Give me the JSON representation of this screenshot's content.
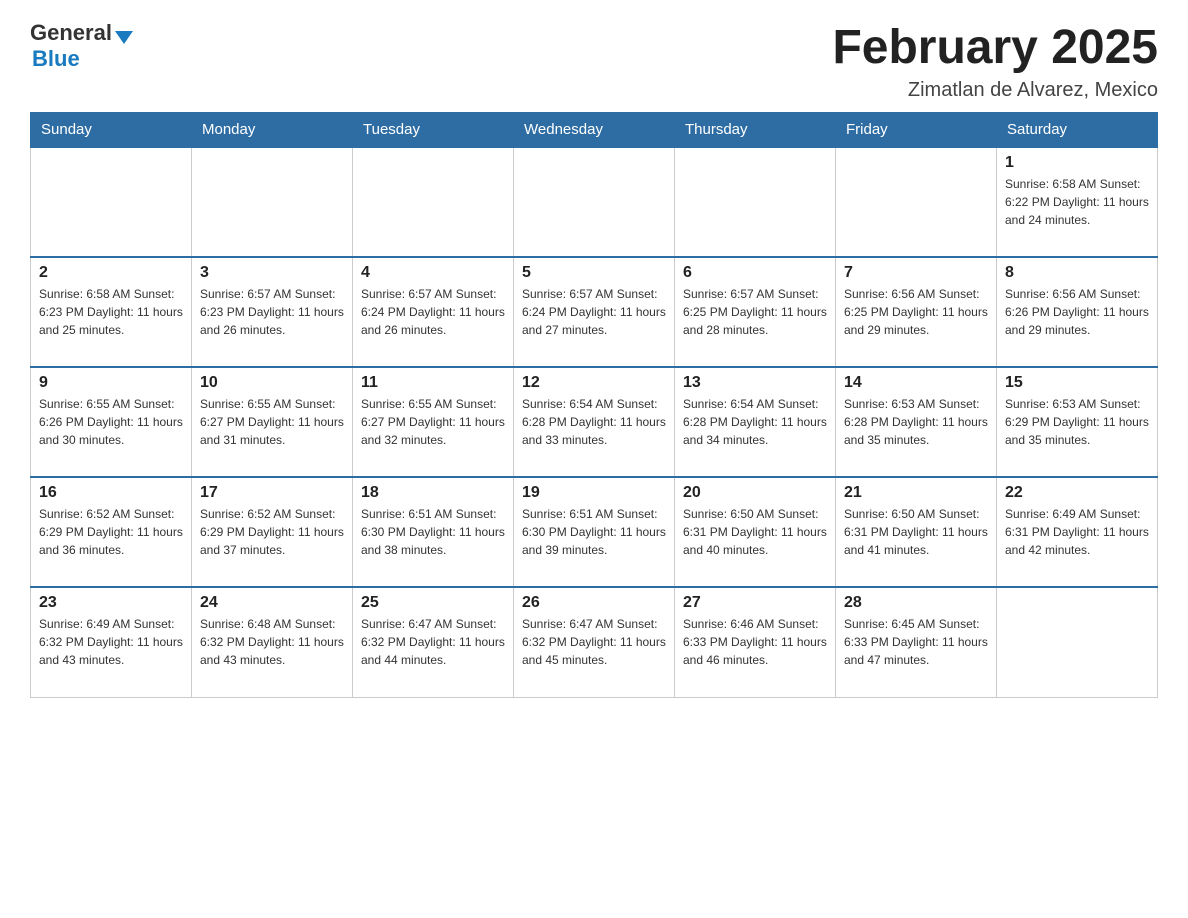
{
  "header": {
    "logo_general": "General",
    "logo_blue": "Blue",
    "title": "February 2025",
    "location": "Zimatlan de Alvarez, Mexico"
  },
  "weekdays": [
    "Sunday",
    "Monday",
    "Tuesday",
    "Wednesday",
    "Thursday",
    "Friday",
    "Saturday"
  ],
  "weeks": [
    [
      {
        "day": "",
        "info": ""
      },
      {
        "day": "",
        "info": ""
      },
      {
        "day": "",
        "info": ""
      },
      {
        "day": "",
        "info": ""
      },
      {
        "day": "",
        "info": ""
      },
      {
        "day": "",
        "info": ""
      },
      {
        "day": "1",
        "info": "Sunrise: 6:58 AM\nSunset: 6:22 PM\nDaylight: 11 hours and 24 minutes."
      }
    ],
    [
      {
        "day": "2",
        "info": "Sunrise: 6:58 AM\nSunset: 6:23 PM\nDaylight: 11 hours and 25 minutes."
      },
      {
        "day": "3",
        "info": "Sunrise: 6:57 AM\nSunset: 6:23 PM\nDaylight: 11 hours and 26 minutes."
      },
      {
        "day": "4",
        "info": "Sunrise: 6:57 AM\nSunset: 6:24 PM\nDaylight: 11 hours and 26 minutes."
      },
      {
        "day": "5",
        "info": "Sunrise: 6:57 AM\nSunset: 6:24 PM\nDaylight: 11 hours and 27 minutes."
      },
      {
        "day": "6",
        "info": "Sunrise: 6:57 AM\nSunset: 6:25 PM\nDaylight: 11 hours and 28 minutes."
      },
      {
        "day": "7",
        "info": "Sunrise: 6:56 AM\nSunset: 6:25 PM\nDaylight: 11 hours and 29 minutes."
      },
      {
        "day": "8",
        "info": "Sunrise: 6:56 AM\nSunset: 6:26 PM\nDaylight: 11 hours and 29 minutes."
      }
    ],
    [
      {
        "day": "9",
        "info": "Sunrise: 6:55 AM\nSunset: 6:26 PM\nDaylight: 11 hours and 30 minutes."
      },
      {
        "day": "10",
        "info": "Sunrise: 6:55 AM\nSunset: 6:27 PM\nDaylight: 11 hours and 31 minutes."
      },
      {
        "day": "11",
        "info": "Sunrise: 6:55 AM\nSunset: 6:27 PM\nDaylight: 11 hours and 32 minutes."
      },
      {
        "day": "12",
        "info": "Sunrise: 6:54 AM\nSunset: 6:28 PM\nDaylight: 11 hours and 33 minutes."
      },
      {
        "day": "13",
        "info": "Sunrise: 6:54 AM\nSunset: 6:28 PM\nDaylight: 11 hours and 34 minutes."
      },
      {
        "day": "14",
        "info": "Sunrise: 6:53 AM\nSunset: 6:28 PM\nDaylight: 11 hours and 35 minutes."
      },
      {
        "day": "15",
        "info": "Sunrise: 6:53 AM\nSunset: 6:29 PM\nDaylight: 11 hours and 35 minutes."
      }
    ],
    [
      {
        "day": "16",
        "info": "Sunrise: 6:52 AM\nSunset: 6:29 PM\nDaylight: 11 hours and 36 minutes."
      },
      {
        "day": "17",
        "info": "Sunrise: 6:52 AM\nSunset: 6:29 PM\nDaylight: 11 hours and 37 minutes."
      },
      {
        "day": "18",
        "info": "Sunrise: 6:51 AM\nSunset: 6:30 PM\nDaylight: 11 hours and 38 minutes."
      },
      {
        "day": "19",
        "info": "Sunrise: 6:51 AM\nSunset: 6:30 PM\nDaylight: 11 hours and 39 minutes."
      },
      {
        "day": "20",
        "info": "Sunrise: 6:50 AM\nSunset: 6:31 PM\nDaylight: 11 hours and 40 minutes."
      },
      {
        "day": "21",
        "info": "Sunrise: 6:50 AM\nSunset: 6:31 PM\nDaylight: 11 hours and 41 minutes."
      },
      {
        "day": "22",
        "info": "Sunrise: 6:49 AM\nSunset: 6:31 PM\nDaylight: 11 hours and 42 minutes."
      }
    ],
    [
      {
        "day": "23",
        "info": "Sunrise: 6:49 AM\nSunset: 6:32 PM\nDaylight: 11 hours and 43 minutes."
      },
      {
        "day": "24",
        "info": "Sunrise: 6:48 AM\nSunset: 6:32 PM\nDaylight: 11 hours and 43 minutes."
      },
      {
        "day": "25",
        "info": "Sunrise: 6:47 AM\nSunset: 6:32 PM\nDaylight: 11 hours and 44 minutes."
      },
      {
        "day": "26",
        "info": "Sunrise: 6:47 AM\nSunset: 6:32 PM\nDaylight: 11 hours and 45 minutes."
      },
      {
        "day": "27",
        "info": "Sunrise: 6:46 AM\nSunset: 6:33 PM\nDaylight: 11 hours and 46 minutes."
      },
      {
        "day": "28",
        "info": "Sunrise: 6:45 AM\nSunset: 6:33 PM\nDaylight: 11 hours and 47 minutes."
      },
      {
        "day": "",
        "info": ""
      }
    ]
  ]
}
